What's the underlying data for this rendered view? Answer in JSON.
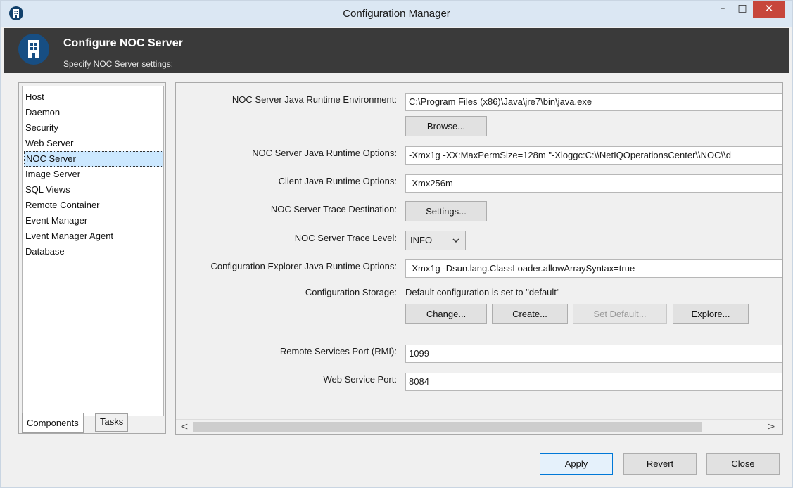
{
  "window": {
    "title": "Configuration Manager",
    "minimize_glyph": "–",
    "maximize_glyph": "□",
    "close_glyph": "✕"
  },
  "banner": {
    "title": "Configure NOC Server",
    "subtitle": "Specify NOC Server settings:"
  },
  "sidebar": {
    "items": [
      {
        "label": "Host",
        "selected": false
      },
      {
        "label": "Daemon",
        "selected": false
      },
      {
        "label": "Security",
        "selected": false
      },
      {
        "label": "Web Server",
        "selected": false
      },
      {
        "label": "NOC Server",
        "selected": true
      },
      {
        "label": "Image Server",
        "selected": false
      },
      {
        "label": "SQL Views",
        "selected": false
      },
      {
        "label": "Remote Container",
        "selected": false
      },
      {
        "label": "Event Manager",
        "selected": false
      },
      {
        "label": "Event Manager Agent",
        "selected": false
      },
      {
        "label": "Database",
        "selected": false
      }
    ],
    "tabs": [
      "Components",
      "Tasks"
    ],
    "active_tab": "Components"
  },
  "form": {
    "jre_label": "NOC Server Java Runtime Environment:",
    "jre_value": "C:\\Program Files (x86)\\Java\\jre7\\bin\\java.exe",
    "browse_label": "Browse...",
    "runtime_options_label": "NOC Server Java Runtime Options:",
    "runtime_options_value": "-Xmx1g -XX:MaxPermSize=128m \"-Xloggc:C:\\\\NetIQOperationsCenter\\\\NOC\\\\d",
    "client_options_label": "Client Java Runtime Options:",
    "client_options_value": "-Xmx256m",
    "trace_destination_label": "NOC Server Trace Destination:",
    "settings_label": "Settings...",
    "trace_level_label": "NOC Server Trace Level:",
    "trace_level_value": "INFO",
    "explorer_options_label": "Configuration Explorer Java Runtime Options:",
    "explorer_options_value": "-Xmx1g -Dsun.lang.ClassLoader.allowArraySyntax=true",
    "storage_label": "Configuration Storage:",
    "storage_value": "Default configuration is set to \"default\"",
    "change_label": "Change...",
    "create_label": "Create...",
    "set_default_label": "Set Default...",
    "explore_label": "Explore...",
    "rmi_port_label": "Remote Services Port (RMI):",
    "rmi_port_value": "1099",
    "web_port_label": "Web Service Port:",
    "web_port_value": "8084"
  },
  "scrollbar": {
    "left_glyph": "<",
    "right_glyph": ">"
  },
  "footer": {
    "apply_label": "Apply",
    "revert_label": "Revert",
    "close_label": "Close"
  },
  "colors": {
    "titlebar": "#dbe7f3",
    "banner": "#3a3a3a",
    "selection": "#cce8ff",
    "close_button": "#c7463b",
    "primary_border": "#0078d7"
  }
}
